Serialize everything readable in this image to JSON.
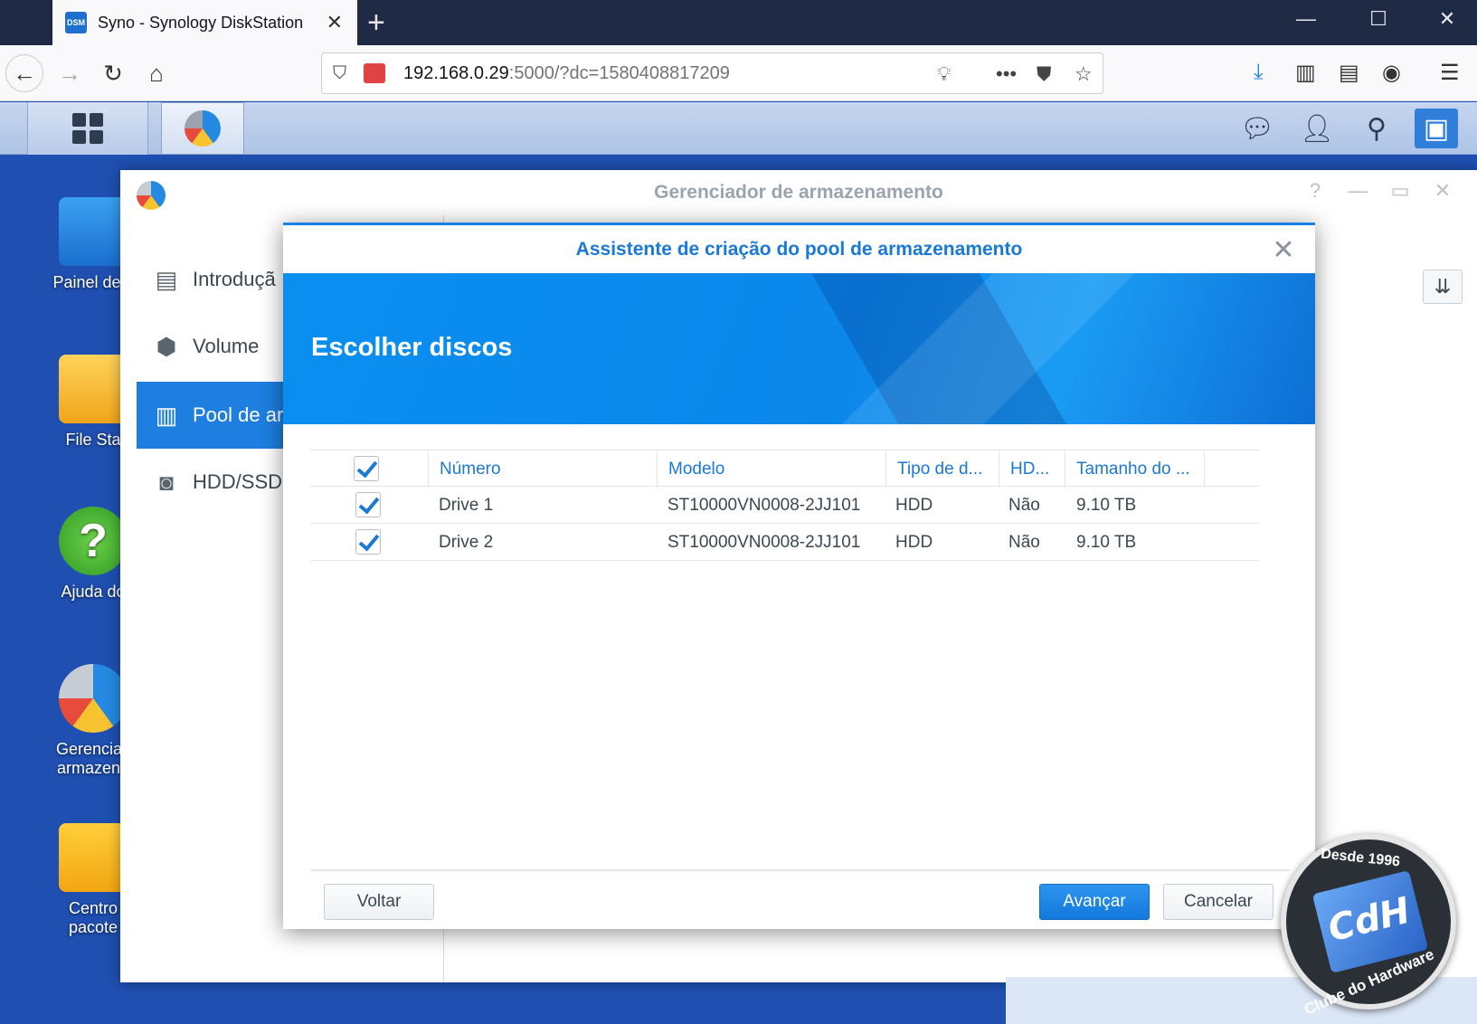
{
  "browser": {
    "tab_title": "Syno - Synology DiskStation",
    "favicon_text": "DSM",
    "url_host": "192.168.0.29",
    "url_rest": ":5000/?dc=1580408817209"
  },
  "desktop": {
    "icons": [
      {
        "label": "Painel de c"
      },
      {
        "label": "File Sta"
      },
      {
        "label": "Ajuda do"
      },
      {
        "label": "Gerenciac armazena"
      },
      {
        "label": "Centro pacote"
      }
    ]
  },
  "storage_manager": {
    "title": "Gerenciador de armazenamento",
    "nav": [
      {
        "label": "Introduçã",
        "icon": "overview-icon"
      },
      {
        "label": "Volume",
        "icon": "cubes-icon"
      },
      {
        "label": "Pool de ar",
        "icon": "pool-icon"
      },
      {
        "label": "HDD/SSD",
        "icon": "disk-icon"
      }
    ]
  },
  "wizard": {
    "title": "Assistente de criação do pool de armazenamento",
    "heading": "Escolher discos",
    "columns": [
      "Número",
      "Modelo",
      "Tipo de d...",
      "HD...",
      "Tamanho do ..."
    ],
    "rows": [
      {
        "number": "Drive 1",
        "model": "ST10000VN0008-2JJ101",
        "type": "HDD",
        "hd": "Não",
        "size": "9.10 TB",
        "checked": true
      },
      {
        "number": "Drive 2",
        "model": "ST10000VN0008-2JJ101",
        "type": "HDD",
        "hd": "Não",
        "size": "9.10 TB",
        "checked": true
      }
    ],
    "buttons": {
      "back": "Voltar",
      "next": "Avançar",
      "cancel": "Cancelar"
    }
  },
  "watermark": {
    "since": "Desde 1996",
    "logo": "CdH",
    "brand": "Clube do Hardware"
  },
  "colors": {
    "accent": "#1a78d6",
    "desktop_bg": "#1f4fb0",
    "banner": "#0a8ff0"
  }
}
